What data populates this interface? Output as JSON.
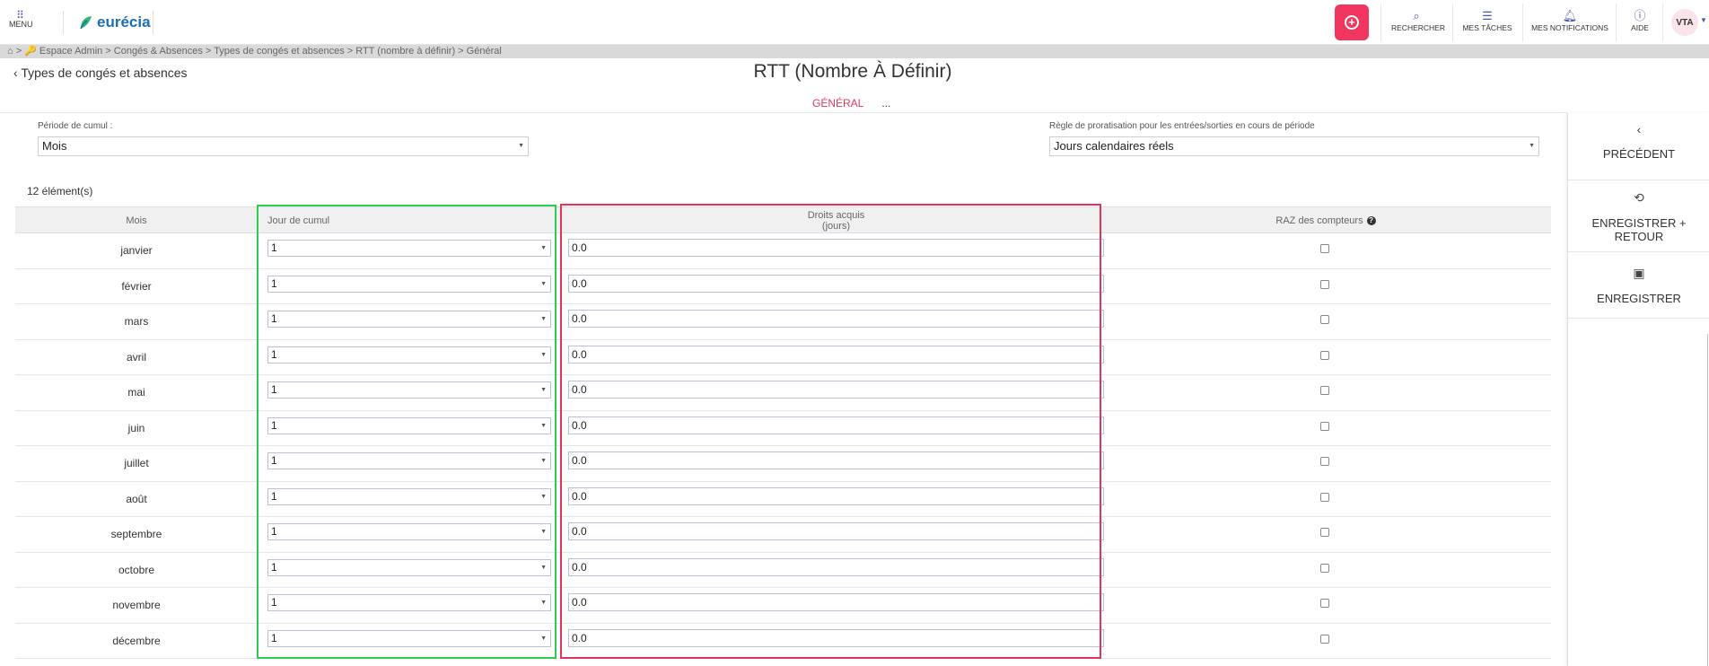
{
  "topbar": {
    "menu_label": "MENU",
    "logo_text": "eurécia",
    "tools": [
      {
        "label": "RECHERCHER",
        "icon": "search-icon"
      },
      {
        "label": "MES TÂCHES",
        "icon": "tasks-icon"
      },
      {
        "label": "MES NOTIFICATIONS",
        "icon": "bell-icon"
      },
      {
        "label": "AIDE",
        "icon": "help-icon"
      }
    ],
    "avatar": "VTA",
    "accent_color": "#f0365e"
  },
  "breadcrumb": "⌂ > 🔑 Espace Admin > Congés & Absences > Types de congés et absences > RTT (nombre à définir) > Général",
  "header": {
    "back_label": "Types de congés et absences",
    "title": "RTT (Nombre À Définir)",
    "tabs": [
      {
        "label": "GÉNÉRAL",
        "active": true
      },
      {
        "label": "...",
        "active": false
      }
    ]
  },
  "form": {
    "periode_label": "Période de cumul :",
    "periode_value": "Mois",
    "regle_label": "Règle de proratisation pour les entrées/sorties en cours de période",
    "regle_value": "Jours calendaires réels"
  },
  "table": {
    "count": "12 élément(s)",
    "headers": {
      "mois": "Mois",
      "jour": "Jour de cumul",
      "droits_line1": "Droits acquis",
      "droits_line2": "(jours)",
      "raz": "RAZ des compteurs"
    },
    "rows": [
      {
        "mois": "janvier",
        "jour": "1",
        "droits": "0.0"
      },
      {
        "mois": "février",
        "jour": "1",
        "droits": "0.0"
      },
      {
        "mois": "mars",
        "jour": "1",
        "droits": "0.0"
      },
      {
        "mois": "avril",
        "jour": "1",
        "droits": "0.0"
      },
      {
        "mois": "mai",
        "jour": "1",
        "droits": "0.0"
      },
      {
        "mois": "juin",
        "jour": "1",
        "droits": "0.0"
      },
      {
        "mois": "juillet",
        "jour": "1",
        "droits": "0.0"
      },
      {
        "mois": "août",
        "jour": "1",
        "droits": "0.0"
      },
      {
        "mois": "septembre",
        "jour": "1",
        "droits": "0.0"
      },
      {
        "mois": "octobre",
        "jour": "1",
        "droits": "0.0"
      },
      {
        "mois": "novembre",
        "jour": "1",
        "droits": "0.0"
      },
      {
        "mois": "décembre",
        "jour": "1",
        "droits": "0.0"
      }
    ]
  },
  "sidebar": {
    "precedent": "PRÉCÉDENT",
    "save_return_line1": "ENREGISTRER +",
    "save_return_line2": "RETOUR",
    "save": "ENREGISTRER"
  }
}
